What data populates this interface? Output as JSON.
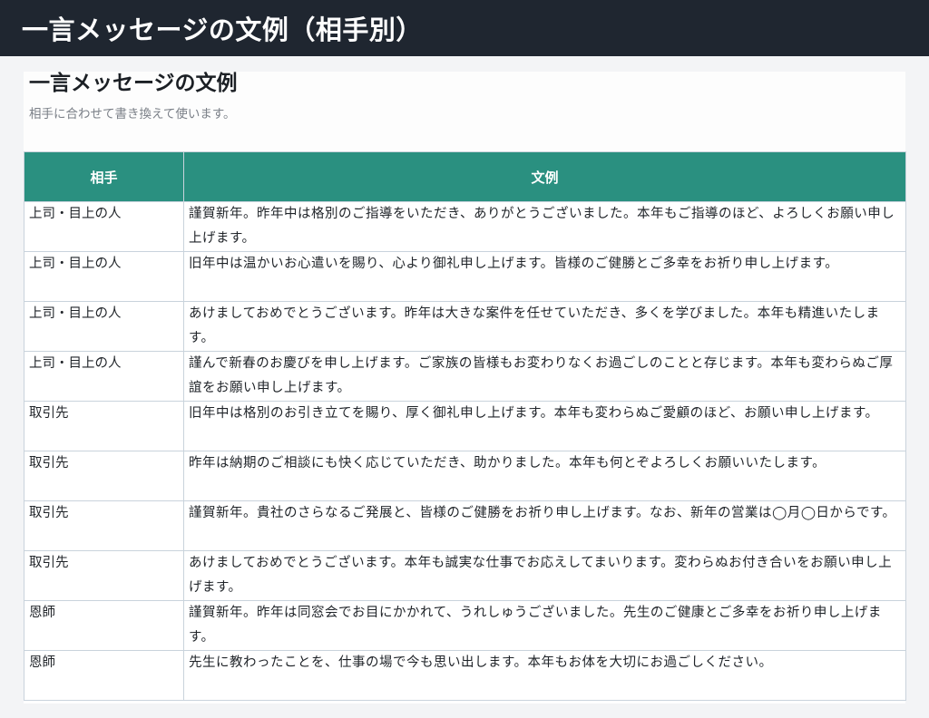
{
  "header": {
    "title": "一言メッセージの文例（相手別）"
  },
  "card": {
    "title": "一言メッセージの文例",
    "subtitle": "相手に合わせて書き換えて使います。"
  },
  "table": {
    "headers": [
      "相手",
      "文例"
    ],
    "rows": [
      {
        "recipient": "上司・目上の人",
        "message": "謹賀新年。昨年中は格別のご指導をいただき、ありがとうございました。本年もご指導のほど、よろしくお願い申し上げます。"
      },
      {
        "recipient": "上司・目上の人",
        "message": "旧年中は温かいお心遣いを賜り、心より御礼申し上げます。皆様のご健勝とご多幸をお祈り申し上げます。"
      },
      {
        "recipient": "上司・目上の人",
        "message": "あけましておめでとうございます。昨年は大きな案件を任せていただき、多くを学びました。本年も精進いたします。"
      },
      {
        "recipient": "上司・目上の人",
        "message": "謹んで新春のお慶びを申し上げます。ご家族の皆様もお変わりなくお過ごしのことと存じます。本年も変わらぬご厚誼をお願い申し上げます。"
      },
      {
        "recipient": "取引先",
        "message": "旧年中は格別のお引き立てを賜り、厚く御礼申し上げます。本年も変わらぬご愛顧のほど、お願い申し上げます。"
      },
      {
        "recipient": "取引先",
        "message": "昨年は納期のご相談にも快く応じていただき、助かりました。本年も何とぞよろしくお願いいたします。"
      },
      {
        "recipient": "取引先",
        "message": "謹賀新年。貴社のさらなるご発展と、皆様のご健勝をお祈り申し上げます。なお、新年の営業は◯月◯日からです。"
      },
      {
        "recipient": "取引先",
        "message": "あけましておめでとうございます。本年も誠実な仕事でお応えしてまいります。変わらぬお付き合いをお願い申し上げます。"
      },
      {
        "recipient": "恩師",
        "message": "謹賀新年。昨年は同窓会でお目にかかれて、うれしゅうございました。先生のご健康とご多幸をお祈り申し上げます。"
      },
      {
        "recipient": "恩師",
        "message": "先生に教わったことを、仕事の場で今も思い出します。本年もお体を大切にお過ごしください。"
      }
    ]
  }
}
